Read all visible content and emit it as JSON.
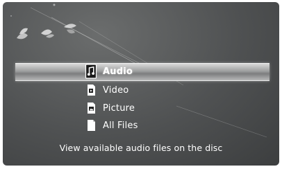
{
  "menu": {
    "items": [
      {
        "label": "Audio",
        "icon": "music-file-icon",
        "selected": true
      },
      {
        "label": "Video",
        "icon": "video-file-icon",
        "selected": false
      },
      {
        "label": "Picture",
        "icon": "picture-file-icon",
        "selected": false
      },
      {
        "label": "All Files",
        "icon": "file-icon",
        "selected": false
      }
    ]
  },
  "hint": "View available audio files on the disc",
  "colors": {
    "background": "#4f5152",
    "text": "#ffffff",
    "highlight": "#b8b9b9"
  }
}
